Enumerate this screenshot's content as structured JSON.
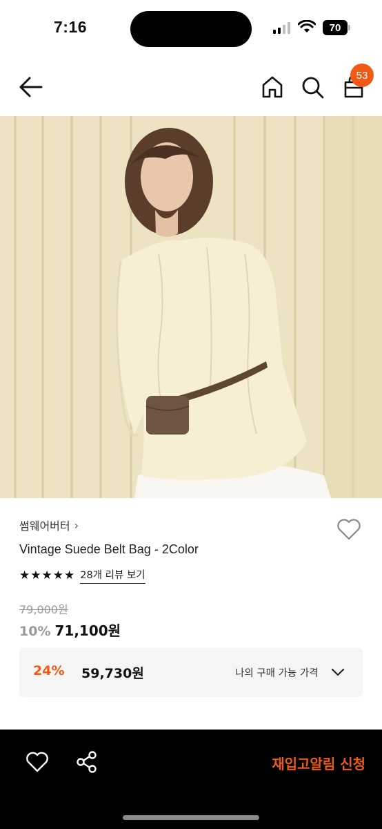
{
  "status_bar": {
    "time": "7:16",
    "battery": "70"
  },
  "header": {
    "cart_count": "53"
  },
  "colors": {
    "accent": "#ef5a16",
    "bottom_bar": "#000000"
  },
  "icons": [
    "back-arrow-icon",
    "home-icon",
    "search-icon",
    "shopping-bag-icon",
    "heart-icon",
    "share-icon",
    "chevron-down-icon"
  ],
  "product": {
    "brand": "썸웨어버터",
    "brand_chevron": "›",
    "title": "Vintage Suede Belt Bag - 2Color",
    "rating_stars": 5,
    "review_link": "28개 리뷰 보기",
    "original_price": "79,000원",
    "discount": "10%",
    "price": "71,100원"
  },
  "best_price": {
    "discount": "24%",
    "price": "59,730원",
    "label": "나의 구매 가능 가격"
  },
  "bottom_bar": {
    "restock_button": "재입고알림 신청"
  }
}
